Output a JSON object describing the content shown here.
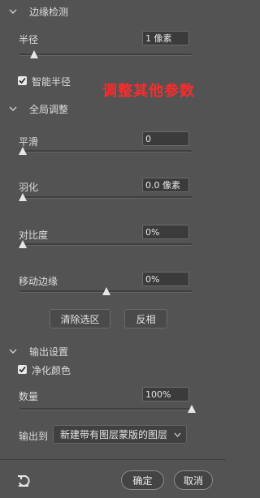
{
  "sections": {
    "edge_detection": {
      "title": "边缘检测"
    },
    "global_adjust": {
      "title": "全局调整"
    },
    "output": {
      "title": "输出设置"
    }
  },
  "edge": {
    "radius": {
      "label": "半径",
      "value": "1 像素",
      "level": 0.06
    },
    "smart_radius": {
      "label": "智能半径",
      "checked": true
    }
  },
  "annotation": {
    "text": "调整其他参数"
  },
  "global": {
    "smooth": {
      "label": "平滑",
      "value": "0",
      "level": 0.0
    },
    "feather": {
      "label": "羽化",
      "value": "0.0 像素",
      "level": 0.0
    },
    "contrast": {
      "label": "对比度",
      "value": "0%",
      "level": 0.0
    },
    "shift_edge": {
      "label": "移动边缘",
      "value": "0%",
      "level": 0.5
    },
    "clear_selection_label": "清除选区",
    "invert_label": "反相"
  },
  "output": {
    "decontaminate": {
      "label": "净化颜色",
      "checked": true
    },
    "amount": {
      "label": "数量",
      "value": "100%",
      "level": 1.0
    },
    "output_to": {
      "label": "输出到",
      "selected": "新建带有图层蒙版的图层"
    }
  },
  "footer": {
    "ok_label": "确定",
    "cancel_label": "取消"
  },
  "colors": {
    "background": "#535353",
    "annotation": "#ff2a2a"
  }
}
